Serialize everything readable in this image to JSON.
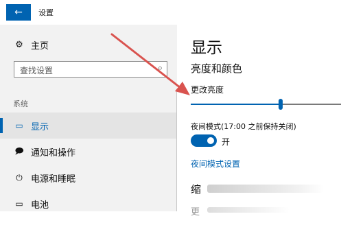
{
  "app": {
    "title": "设置",
    "back_icon": "arrow-left-icon",
    "back_glyph": "←"
  },
  "sidebar": {
    "home_label": "主页",
    "home_icon": "gear-icon",
    "search_placeholder": "查找设置",
    "section_label": "系统",
    "items": [
      {
        "label": "显示",
        "icon": "monitor-icon",
        "active": true
      },
      {
        "label": "通知和操作",
        "icon": "speech-bubble-icon",
        "active": false
      },
      {
        "label": "电源和睡眠",
        "icon": "power-icon",
        "active": false
      },
      {
        "label": "电池",
        "icon": "battery-icon",
        "active": false
      }
    ]
  },
  "content": {
    "title": "显示",
    "subtitle": "亮度和颜色",
    "brightness_label": "更改亮度",
    "brightness_value": 0.6,
    "night_light_label": "夜间模式(17:00 之前保持关闭)",
    "toggle_on": true,
    "toggle_state": "开",
    "night_light_link": "夜间模式设置",
    "scale_heading_partial": "缩",
    "next_heading_partial": "更"
  },
  "annotation": {
    "arrow_color": "#d9534f"
  },
  "colors": {
    "accent": "#0063b1",
    "sidebar_bg": "#f2f2f2",
    "active_bg": "#e4e4e4"
  }
}
